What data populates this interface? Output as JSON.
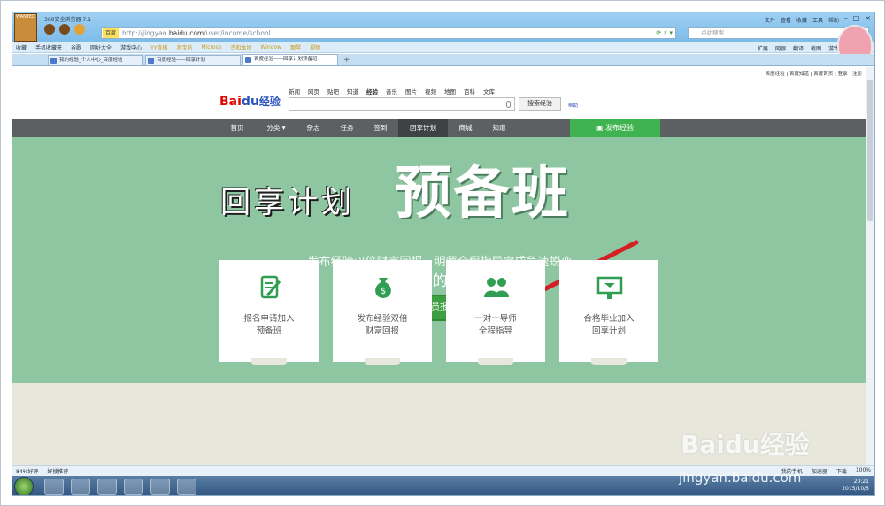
{
  "browser": {
    "app_title": "360安全浏览器 7.1",
    "address": {
      "engine": "百度",
      "url_prefix": "http://jingyan.",
      "url_domain": "baidu.com",
      "url_path": "/user/income/school"
    },
    "search_placeholder": "点此搜索",
    "top_menu": [
      "文件",
      "查看",
      "收藏",
      "工具",
      "帮助"
    ],
    "bookmarks": [
      "收藏",
      "手机收藏夹",
      "谷歌",
      "网址大全",
      "游戏中心",
      "YY直播",
      "淘宝坊",
      "Microso",
      "杰和本地",
      "Window",
      "靓琴",
      "视频"
    ],
    "bookmarks_right": [
      "扩展",
      "网银",
      "翻译",
      "截图",
      "游戏"
    ],
    "tabs": [
      "我的经验_个人中心_百度经验",
      "百度经验——回享计划",
      "百度经验——回享计划预备班"
    ],
    "status_left": [
      "84%好评",
      "好搜推荐"
    ],
    "status_right": [
      "我的手机",
      "加速器",
      "下载",
      "100%"
    ],
    "clock": {
      "time": "20:21",
      "date": "2015/10/5"
    }
  },
  "site": {
    "top_links": "百度经验 | 百度知道 | 百度首页 | 登录 | 注册",
    "logo_text": "Bai",
    "logo_paw": "du",
    "logo_product": "经验",
    "nav_links": [
      "新闻",
      "网页",
      "贴吧",
      "知道",
      "经验",
      "音乐",
      "图片",
      "视频",
      "地图",
      "百科",
      "文库"
    ],
    "search_button": "搜索经验",
    "help_link": "帮助",
    "main_nav": [
      "首页",
      "分类",
      "杂志",
      "任务",
      "签到",
      "回享计划",
      "商城",
      "知道"
    ],
    "publish_button": "发布经验"
  },
  "hero": {
    "title_small": "回享计划",
    "title_large": "预备班",
    "subtitle": "发布经验双倍财富回报，明师全程指导完成急速蜕变",
    "welcome": "欢迎你的加入！",
    "join_button": "学员报名"
  },
  "cards": [
    {
      "icon": "form-icon",
      "line1": "报名申请加入",
      "line2": "预备班"
    },
    {
      "icon": "money-bag-icon",
      "line1": "发布经验双倍",
      "line2": "财富回报"
    },
    {
      "icon": "people-icon",
      "line1": "一对一导师",
      "line2": "全程指导"
    },
    {
      "icon": "graduation-icon",
      "line1": "合格毕业加入",
      "line2": "回享计划"
    }
  ],
  "watermark": {
    "brand": "Baidu经验",
    "url": "jingyan.baidu.com"
  },
  "colors": {
    "hero_green": "#8fc6a2",
    "accent_green": "#3fb34f",
    "nav_gray": "#5d6062",
    "arrow_red": "#d41f24"
  }
}
